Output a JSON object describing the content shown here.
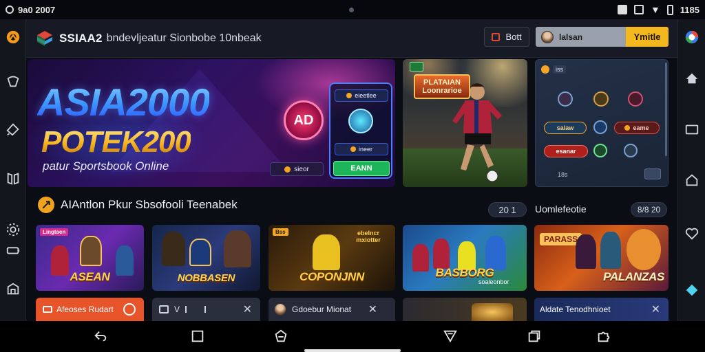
{
  "status_bar": {
    "left_text": "9a0 2007",
    "right_text": "1185"
  },
  "header": {
    "brand": "SSIAA2",
    "subtitle": "bndevljeatur Sionbobe 10nbeak",
    "btn_bott": "Bott",
    "login_value": "lalsan",
    "btn_ymitle": "Ymitle"
  },
  "hero": {
    "title_line1": "ASIA2000",
    "title_line2": "POTEK200",
    "tagline": "patur Sportsbook Online",
    "badge": "AD",
    "panel_top": "eieetlee",
    "panel_mid": "ineer",
    "panel_button": "EANN",
    "small_pill": "sieor"
  },
  "stadium_card": {
    "title": "PLATAIAN Loonrarioe"
  },
  "side_panel": {
    "tag": "iss",
    "pill_left": "salaw",
    "pill_right": "eame",
    "pill_red": "esanar",
    "footer": "18s",
    "accent": "#f5a623"
  },
  "section": {
    "title": "AIAntlon Pkur Sbsofooli Teenabek",
    "count_pill": "20 1",
    "side_title": "Uomlefeotie",
    "side_pill": "8/8 20"
  },
  "games": [
    {
      "tag": "Lingtaen",
      "label": "ASEAN"
    },
    {
      "tag": "",
      "label": "NOBBASEN"
    },
    {
      "tag": "Bss",
      "label": "COPONJNN",
      "top_text": "ebelncr mxiotter"
    },
    {
      "tag": "",
      "label": "BASBORG",
      "sub": "soaleonbor"
    },
    {
      "tag": "",
      "label": "PALANZAS",
      "top_text": "PARASS"
    }
  ],
  "bottom_strip": {
    "s1": "Afeoses Rudart",
    "s2": "V",
    "s3": "Gdoebur Mionat",
    "s5": "Aldate Tenodhnioet"
  }
}
